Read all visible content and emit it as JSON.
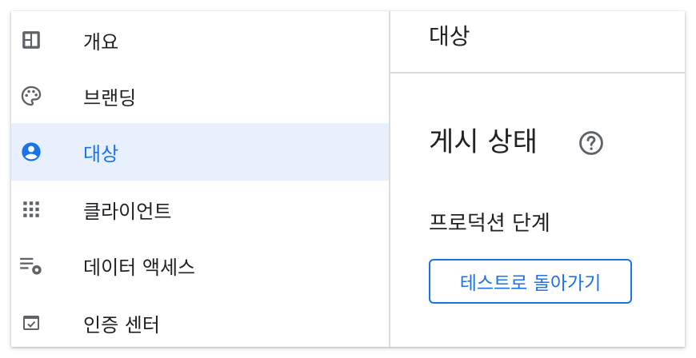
{
  "sidebar": {
    "items": [
      {
        "label": "개요",
        "icon": "dashboard-icon",
        "active": false
      },
      {
        "label": "브랜딩",
        "icon": "palette-icon",
        "active": false
      },
      {
        "label": "대상",
        "icon": "account-circle-icon",
        "active": true
      },
      {
        "label": "클라이언트",
        "icon": "apps-grid-icon",
        "active": false
      },
      {
        "label": "데이터 액세스",
        "icon": "data-settings-icon",
        "active": false
      },
      {
        "label": "인증 센터",
        "icon": "verified-checkbox-icon",
        "active": false
      }
    ]
  },
  "main": {
    "header_title": "대상",
    "section_title": "게시 상태",
    "help_icon": "help-circle-icon",
    "stage_label": "프로덕션 단계",
    "back_button_label": "테스트로 돌아가기"
  },
  "colors": {
    "accent": "#1a73e8",
    "active_background": "#e8f0fe",
    "icon_gray": "#5f6368",
    "text": "#202124",
    "divider": "#dadce0"
  }
}
